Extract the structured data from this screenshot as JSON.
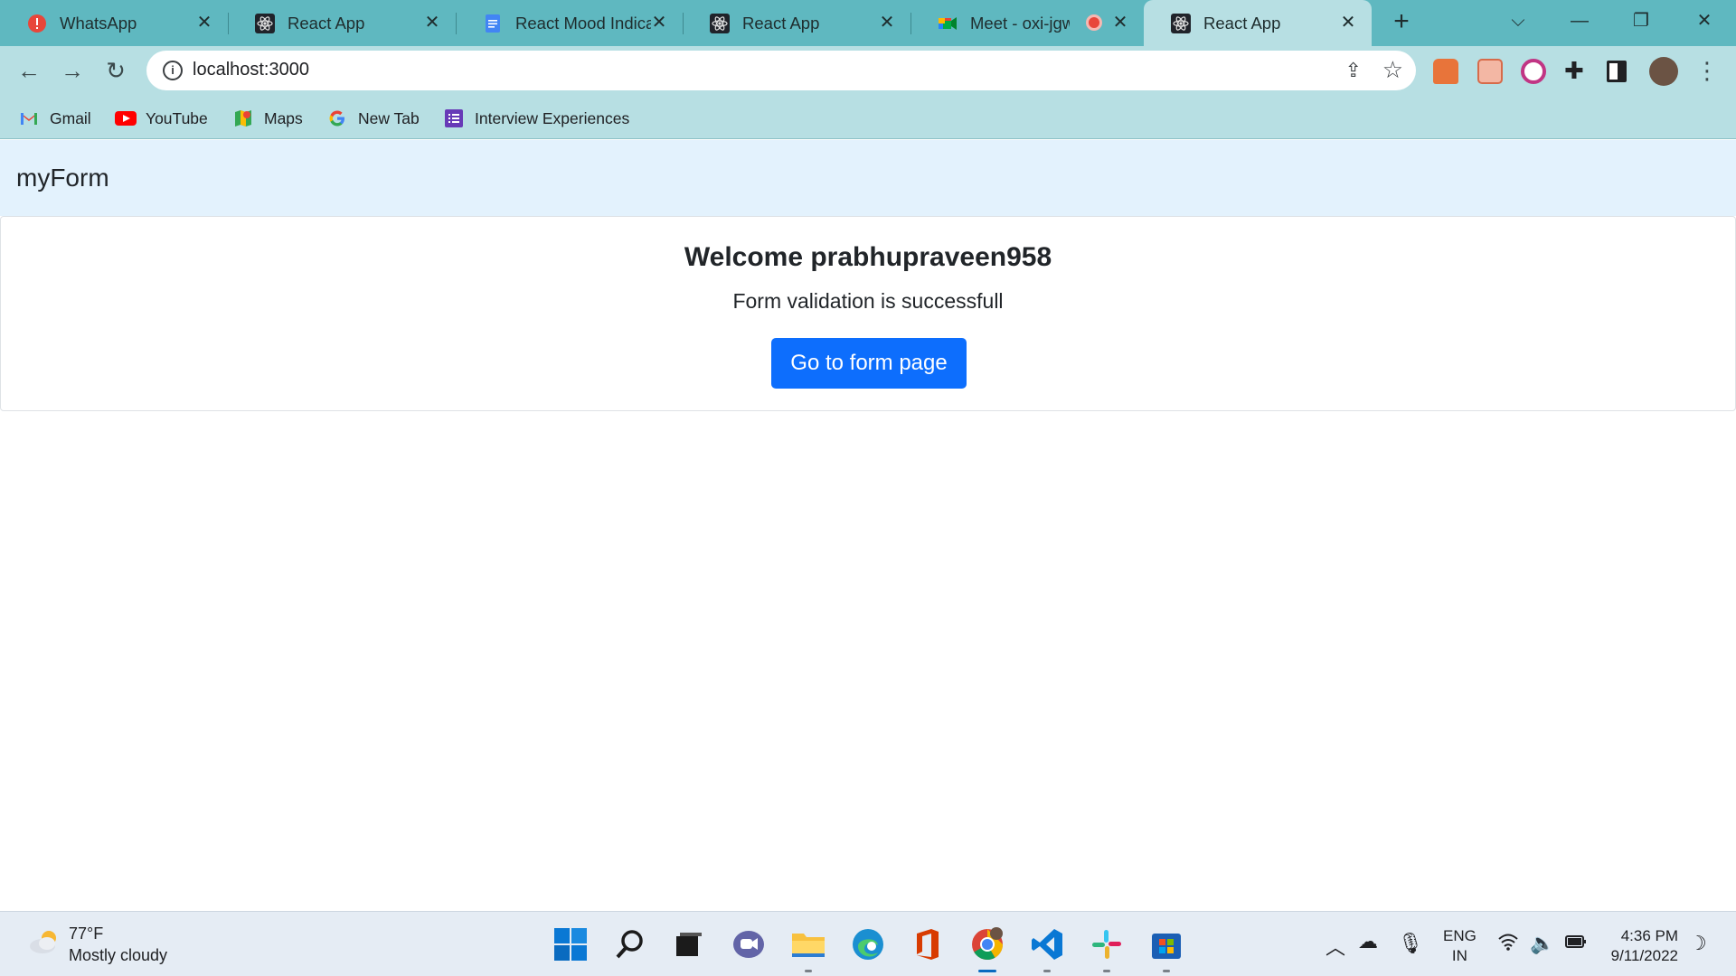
{
  "browser": {
    "tabs": [
      {
        "label": "WhatsApp",
        "icon": "whatsapp-alert-icon",
        "active": false
      },
      {
        "label": "React App",
        "icon": "react-icon",
        "active": false
      },
      {
        "label": "React Mood Indicat",
        "icon": "google-docs-icon",
        "active": false
      },
      {
        "label": "React App",
        "icon": "react-icon",
        "active": false
      },
      {
        "label": "Meet - oxi-jgw",
        "icon": "google-meet-icon",
        "active": false
      },
      {
        "label": "React App",
        "icon": "react-icon",
        "active": true
      }
    ],
    "url": "localhost:3000",
    "bookmarks": [
      {
        "label": "Gmail",
        "icon": "gmail-icon"
      },
      {
        "label": "YouTube",
        "icon": "youtube-icon"
      },
      {
        "label": "Maps",
        "icon": "maps-icon"
      },
      {
        "label": "New Tab",
        "icon": "google-icon"
      },
      {
        "label": "Interview Experiences",
        "icon": "forms-icon"
      }
    ]
  },
  "page": {
    "brand": "myForm",
    "welcome": "Welcome prabhupraveen958",
    "message": "Form validation is successfull",
    "button_label": "Go to form page",
    "accent_color": "#0d6efd",
    "navbar_color": "#e3f2fd"
  },
  "taskbar": {
    "weather": {
      "temp": "77°F",
      "condition": "Mostly cloudy"
    },
    "lang": {
      "line1": "ENG",
      "line2": "IN"
    },
    "clock": {
      "time": "4:36 PM",
      "date": "9/11/2022"
    }
  }
}
